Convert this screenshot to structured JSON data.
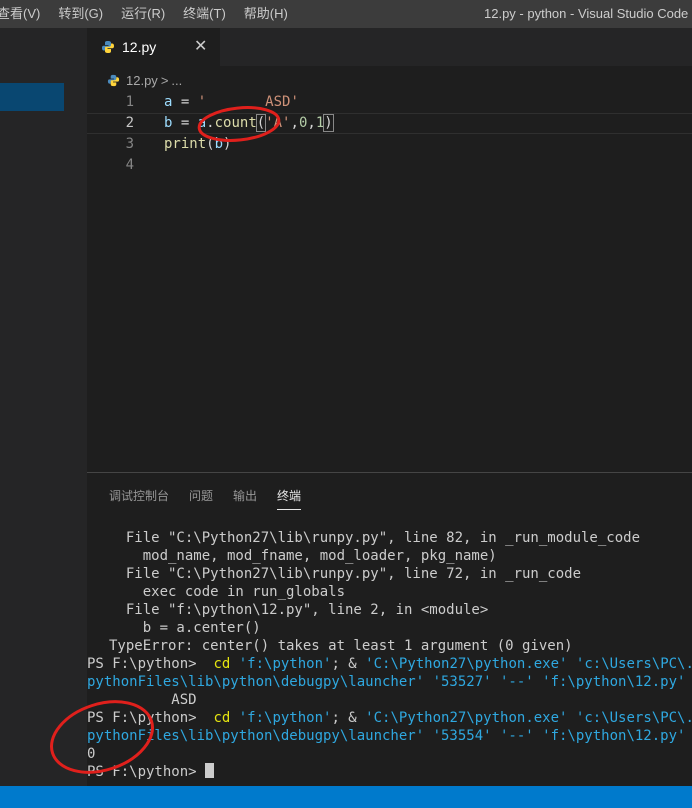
{
  "menu": [
    "查看(V)",
    "转到(G)",
    "运行(R)",
    "终端(T)",
    "帮助(H)"
  ],
  "window_title": "12.py - python - Visual Studio Code",
  "tab": {
    "label": "12.py",
    "close": "✕"
  },
  "breadcrumb": {
    "file": "12.py",
    "sep": ">",
    "more": "..."
  },
  "editor": {
    "line_numbers": [
      "1",
      "2",
      "3",
      "4"
    ]
  },
  "panel": {
    "tabs": [
      "调试控制台",
      "问题",
      "输出",
      "终端"
    ],
    "active_tab": "终端"
  },
  "terminal_lines": [
    "  File \"C:\\Python27\\lib\\runpy.py\", line 82, in _run_module_code",
    "    mod_name, mod_fname, mod_loader, pkg_name)",
    "  File \"C:\\Python27\\lib\\runpy.py\", line 72, in _run_code",
    "    exec code in run_globals",
    "  File \"f:\\python\\12.py\", line 2, in <module>",
    "    b = a.center()",
    "TypeError: center() takes at least 1 argument (0 given)"
  ],
  "prompt": "PS F:\\python>",
  "cmd": {
    "cd": "cd",
    "path_arg": "'f:\\python'",
    "sep": "; & ",
    "exe": "'C:\\Python27\\python.exe'",
    "args_head": "'c:\\Users\\PC\\.vscode\\extensions\\ms-",
    "cont_1": "pythonFiles\\lib\\python\\debugpy\\launcher' '53527' '--' 'f:\\python\\12.py'",
    "cont_2": "pythonFiles\\lib\\python\\debugpy\\launcher' '53554' '--' 'f:\\python\\12.py'"
  },
  "output_1": "          ASD",
  "output_2": "0",
  "colors": {
    "accent": "#007acc",
    "annotation": "#e0201c"
  },
  "icons": [
    "python-file-icon",
    "close-icon",
    "terminal-cursor"
  ]
}
